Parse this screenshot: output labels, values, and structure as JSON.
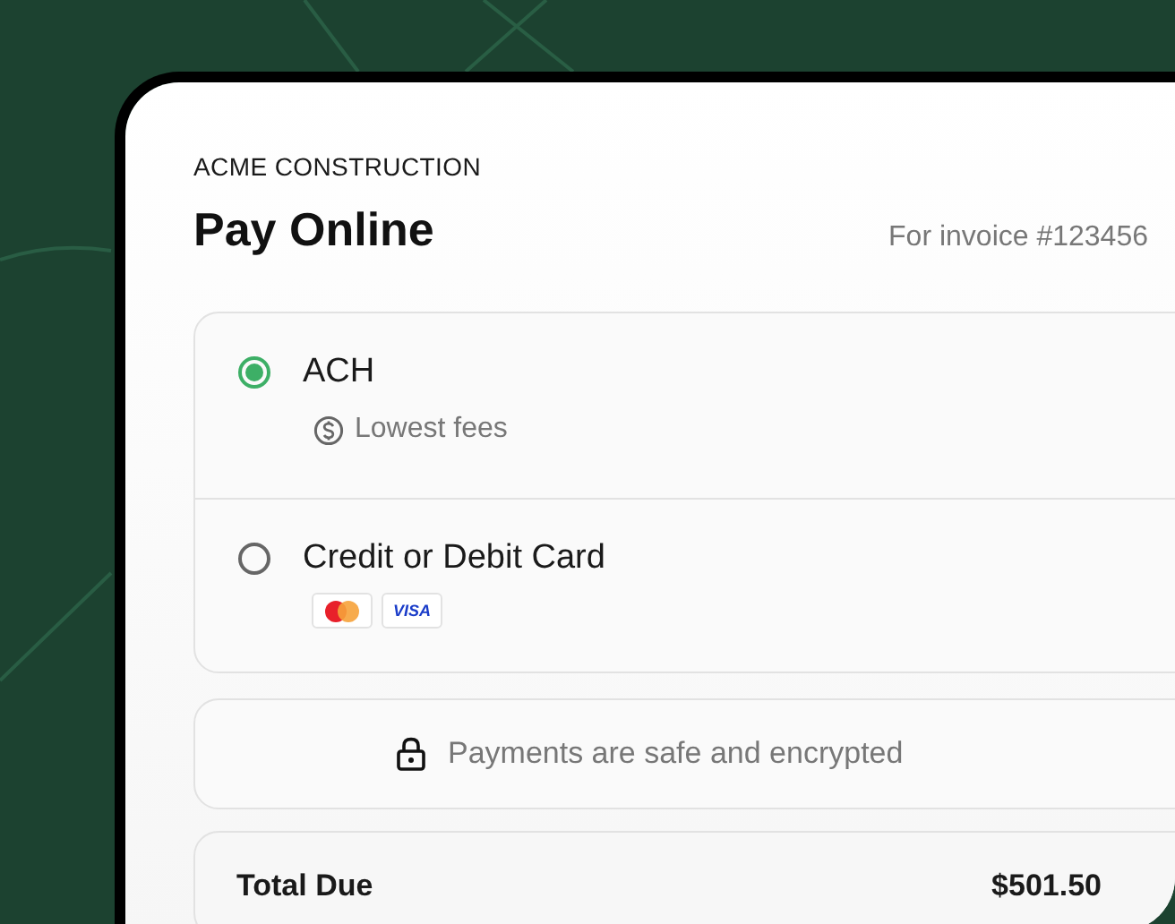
{
  "company": "ACME CONSTRUCTION",
  "title": "Pay Online",
  "invoice": "For invoice #123456",
  "payment_methods": [
    {
      "kind": "ach",
      "label": "ACH",
      "selected": true,
      "note": "Lowest fees"
    },
    {
      "kind": "card",
      "label": "Credit or Debit Card",
      "selected": false,
      "card_logos": [
        {
          "kind": "mastercard"
        },
        {
          "kind": "visa",
          "text": "VISA"
        }
      ]
    }
  ],
  "security_note": "Payments are safe and encrypted",
  "total": {
    "label": "Total Due",
    "amount": "$501.50"
  }
}
